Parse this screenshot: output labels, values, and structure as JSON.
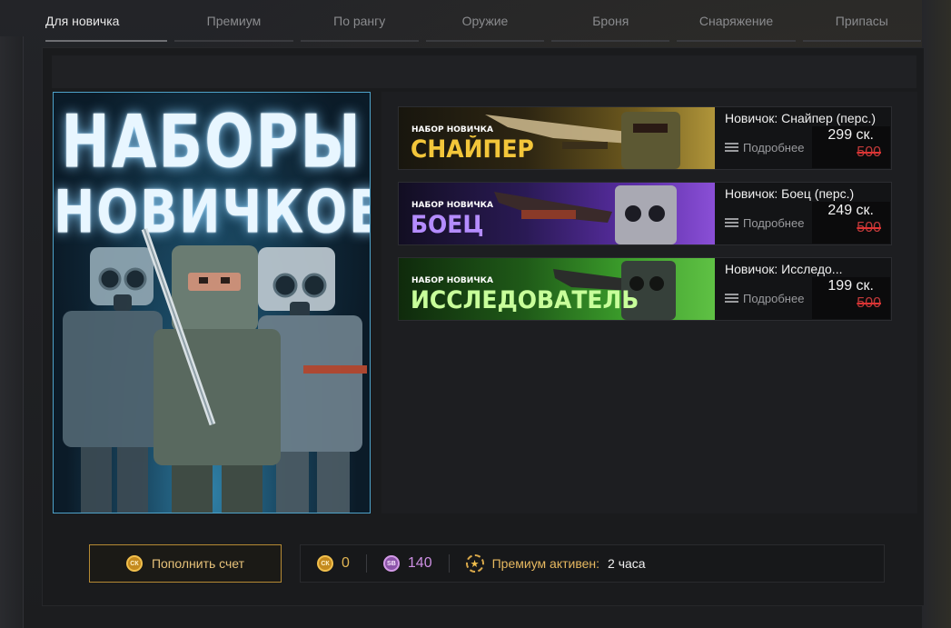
{
  "tabs": [
    {
      "label": "Для новичка",
      "active": true
    },
    {
      "label": "Премиум"
    },
    {
      "label": "По рангу"
    },
    {
      "label": "Оружие"
    },
    {
      "label": "Броня"
    },
    {
      "label": "Снаряжение"
    },
    {
      "label": "Припасы"
    }
  ],
  "poster": {
    "line1": "НАБОРЫ",
    "line2": "НОВИЧКОВ"
  },
  "items": [
    {
      "banner_kit": "НАБОР НОВИЧКА",
      "banner_name": "СНАЙПЕР",
      "title": "Новичок: Снайпер (перс.)",
      "more": "Подробнее",
      "price": "299 ск.",
      "old_price": "500",
      "accent": "#f3c63a"
    },
    {
      "banner_kit": "НАБОР НОВИЧКА",
      "banner_name": "БОЕЦ",
      "title": "Новичок: Боец (перс.)",
      "more": "Подробнее",
      "price": "249 ск.",
      "old_price": "500",
      "accent": "#b48cff"
    },
    {
      "banner_kit": "НАБОР НОВИЧКА",
      "banner_name": "ИССЛЕДОВАТЕЛЬ",
      "title": "Новичок: Исследо...",
      "more": "Подробнее",
      "price": "199 ск.",
      "old_price": "500",
      "accent": "#c8ff9a"
    }
  ],
  "footer": {
    "topup_label": "Пополнить счет",
    "gold_balance": "0",
    "sk_balance": "140",
    "premium_label": "Премиум активен:",
    "premium_value": "2 часа",
    "coin_gold_icon": "gold-coin-icon",
    "coin_sk_icon": "sk-coin-icon"
  }
}
